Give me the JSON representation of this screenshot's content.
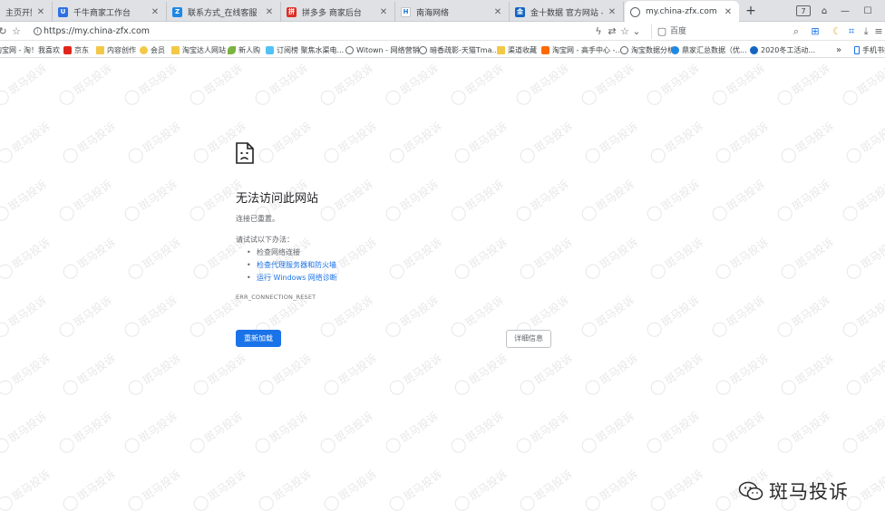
{
  "tabs": [
    {
      "label": "主页开始",
      "color": "#4caf50",
      "glyph": ""
    },
    {
      "label": "千牛商家工作台",
      "color": "#2f6fe4",
      "glyph": "U"
    },
    {
      "label": "联系方式_在线客服 - ZFX山海",
      "color": "#1e88e5",
      "glyph": "Z"
    },
    {
      "label": "拼多多 商家后台",
      "color": "#e02e24",
      "glyph": "拼"
    },
    {
      "label": "南海网络",
      "color": "#1976d2",
      "glyph": "H"
    },
    {
      "label": "金十数据 官方网站 - 一个交易工",
      "color": "#1565c0",
      "glyph": "金"
    },
    {
      "label": "my.china-zfx.com",
      "color": "#9e9e9e",
      "glyph": ""
    }
  ],
  "toolbar": {
    "url": "https://my.china-zfx.com",
    "search_text": "百度",
    "tab_count": "7"
  },
  "bookmarks": [
    {
      "label": "淘宝网 - 淘！我喜欢",
      "color": "#ff6a00",
      "folder": false
    },
    {
      "label": "京东",
      "color": "#e1251b",
      "folder": false
    },
    {
      "label": "内容创作",
      "color": "#f3c846",
      "folder": true
    },
    {
      "label": "会员",
      "color": "#f3c846",
      "folder": false
    },
    {
      "label": "淘宝达人网站",
      "color": "#f3c846",
      "folder": true
    },
    {
      "label": "新人购",
      "color": "#7cb342",
      "folder": false
    },
    {
      "label": "订阅榜 聚焦水渠电...",
      "color": "#4fc3f7",
      "folder": false
    },
    {
      "label": "Witown - 网络营销",
      "color": "#5f6368",
      "folder": false
    },
    {
      "label": "暗香疏影-天猫Tma...",
      "color": "#5f6368",
      "folder": false
    },
    {
      "label": "渠道收藏",
      "color": "#f3c846",
      "folder": true
    },
    {
      "label": "淘宝网 - 高手中心 -...",
      "color": "#ff6a00",
      "folder": false
    },
    {
      "label": "淘宝数据分析",
      "color": "#5f6368",
      "folder": false
    },
    {
      "label": "鼎家汇总数据（优...",
      "color": "#1e88e5",
      "folder": false
    },
    {
      "label": "2020冬工活动...",
      "color": "#1565c0",
      "folder": false
    },
    {
      "label": "手机书签",
      "color": "#1a73e8",
      "folder": false
    }
  ],
  "error": {
    "title": "无法访问此网站",
    "subtitle": "连接已重置。",
    "try_heading": "请试试以下办法：",
    "suggestions": [
      {
        "text": "检查网络连接",
        "link": false
      },
      {
        "text": "检查代理服务器和防火墙",
        "link": true
      },
      {
        "text": "运行 Windows 网络诊断",
        "link": true
      }
    ],
    "code": "ERR_CONNECTION_RESET",
    "reload_label": "重新加载",
    "details_label": "详细信息"
  },
  "watermark": {
    "text": "斑马投诉"
  },
  "brand": {
    "text": "斑马投诉"
  }
}
